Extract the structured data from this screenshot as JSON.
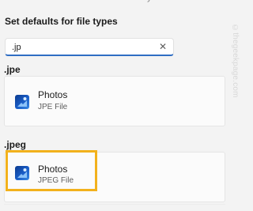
{
  "top_fragment": "by",
  "section": {
    "heading": "Set defaults for file types"
  },
  "search": {
    "value": ".jp",
    "clear_icon": "close-icon"
  },
  "entries": [
    {
      "extension": ".jpe",
      "app_name": "Photos",
      "file_type": "JPE File",
      "icon": "photos-icon"
    },
    {
      "extension": ".jpeg",
      "app_name": "Photos",
      "file_type": "JPEG File",
      "icon": "photos-icon"
    }
  ],
  "watermark": "©thegeekpage.com",
  "colors": {
    "accent": "#2f6dc3",
    "highlight": "#f2b11c",
    "background": "#f3f3f3"
  }
}
